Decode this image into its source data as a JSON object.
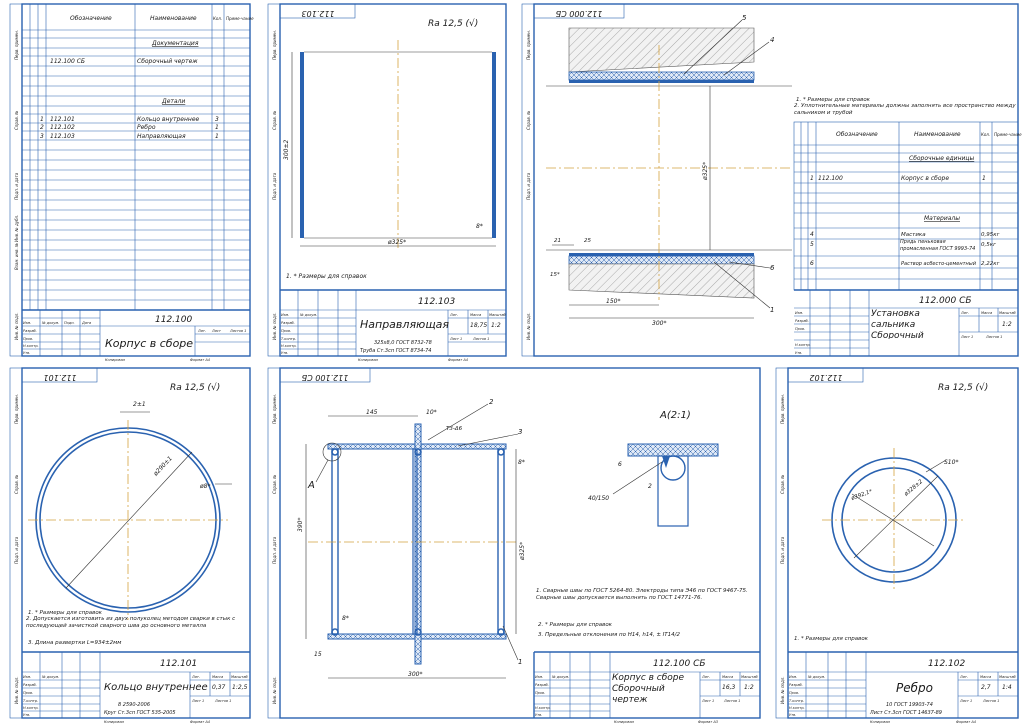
{
  "spec_sheet": {
    "headers": {
      "designation": "Обозначение",
      "name": "Наименование",
      "qty": "Кол.",
      "note": "Приме-чание"
    },
    "section_docs": "Документация",
    "doc_row": {
      "code": "112.100 СБ",
      "name": "Сборочный чертеж"
    },
    "section_parts": "Детали",
    "parts": [
      {
        "pos": "1",
        "code": "112.101",
        "name": "Кольцо внутреннее",
        "qty": "3"
      },
      {
        "pos": "2",
        "code": "112.102",
        "name": "Ребро",
        "qty": "1"
      },
      {
        "pos": "3",
        "code": "112.103",
        "name": "Направляющая",
        "qty": "1"
      }
    ],
    "code": "112.100",
    "title": "Корпус в сборе",
    "copied": "Копировал",
    "format": "Формат А4"
  },
  "guide_sheet": {
    "mirror_code": "112.103",
    "roughness": "Ra 12,5 (√)",
    "dim_height": "300±2",
    "dim_diam": "ø325*",
    "dim_wall": "8*",
    "note": "1. * Размеры для справок",
    "code": "112.103",
    "title": "Направляющая",
    "mass": "18,75",
    "scale": "1:2",
    "material_1": "325х8,0 ГОСТ 8732-78",
    "material_2": "Труба Ст.3сп ГОСТ 8734-74",
    "copied": "Копировал",
    "format": "Формат А4"
  },
  "gland_sheet": {
    "mirror_code": "112.000 СБ",
    "callouts": [
      "5",
      "4",
      "6",
      "1"
    ],
    "dim_diam": "ø325*",
    "dim_21": "21",
    "dim_25": "25",
    "dim_15": "15*",
    "dim_150": "150*",
    "dim_300": "300*",
    "notes": [
      "1. * Размеры для справок",
      "2. Уплотнительные материалы должны заполнять все пространство между сальником и трубой"
    ],
    "headers": {
      "designation": "Обозначение",
      "name": "Наименование",
      "qty": "Кол.",
      "note": "Приме-чание"
    },
    "section_units": "Сборочные единицы",
    "unit_row": {
      "pos": "1",
      "code": "112.100",
      "name": "Корпус в сборе",
      "qty": "1"
    },
    "section_materials": "Материалы",
    "materials": [
      {
        "pos": "4",
        "name": "Мастика",
        "qty": "0,95кг"
      },
      {
        "pos": "5",
        "name": "Прядь пеньковая промасленная ГОСТ 9993-74",
        "qty": "0,5кг"
      },
      {
        "pos": "6",
        "name": "Раствор асбесто-цементный",
        "qty": "2,22кг"
      }
    ],
    "code": "112.000 СБ",
    "title": "Установка сальника Сборочный чертеж",
    "scale": "1:2"
  },
  "ring_sheet": {
    "mirror_code": "112.101",
    "roughness": "Ra 12,5 (√)",
    "dim_gap": "2±1",
    "dim_diam": "ø290±1",
    "dim_wall": "ø8*",
    "notes": [
      "1. * Размеры для справок",
      "2. Допускается изготовить из двух полуколец методом сварки в стык с последующей зачисткой сварного шва до основного металла",
      "3. Длина развертки L=934±2мм"
    ],
    "code": "112.101",
    "title": "Кольцо внутреннее",
    "mass": "0,37",
    "scale": "1:2,5",
    "material_1": "8 2590-2006",
    "material_2": "Круг Ст.3сп ГОСТ 535-2005",
    "copied": "Копировал",
    "format": "Формат А4"
  },
  "assembly_sheet": {
    "mirror_code": "112.100 СБ",
    "callouts": [
      "2",
      "3",
      "1"
    ],
    "dim_145": "145",
    "dim_10": "10*",
    "weld_mark": "Т3-Δ6",
    "view_label": "А",
    "detail_label": "А(2:1)",
    "dim_390": "390*",
    "dim_325": "ø325*",
    "dim_8a": "8*",
    "dim_8b": "8*",
    "dim_15": "15",
    "dim_300": "300*",
    "detail_dim_6": "6",
    "detail_dim_2": "2",
    "detail_dim_40": "40/150",
    "notes": [
      "1. Сварные швы по ГОСТ 5264-80. Электроды типа Э46 по ГОСТ 9467-75. Сварные швы допускается выполнять по ГОСТ 14771-76.",
      "2. * Размеры для справок",
      "3. Предельные отклонения по Н14, h14, ± IT14/2"
    ],
    "code": "112.100 СБ",
    "title": "Корпус в сборе Сборочный чертеж",
    "mass": "16,3",
    "scale": "1:2",
    "copied": "Копировал",
    "format": "Формат А3"
  },
  "rib_sheet": {
    "mirror_code": "112.102",
    "roughness": "Ra 12,5 (√)",
    "dim_thick": "S10*",
    "dim_outer": "ø392,1*",
    "dim_inner": "ø328±2",
    "note": "1. * Размеры для справок",
    "code": "112.102",
    "title": "Ребро",
    "mass": "2,7",
    "scale": "1:4",
    "material_1": "10 ГОСТ 19903-74",
    "material_2": "Лист Ст.3сп ГОСТ 14637-89",
    "copied": "Копировал",
    "format": "Формат А4"
  },
  "stamp_labels": {
    "izm": "Изм.",
    "list": "Лист",
    "ndoc": "№ докум.",
    "podp": "Подп.",
    "data": "Дата",
    "razrab": "Разраб.",
    "prov": "Пров.",
    "tkontr": "Т.контр.",
    "nkontr": "Н.контр.",
    "utv": "Утв.",
    "lit": "Лит.",
    "massa": "Масса",
    "masshtab": "Масштаб",
    "sheet": "Лист",
    "sheets": "Листов 1",
    "sheet_num": "Лист 1"
  },
  "margin_labels": [
    "Перв. примен.",
    "Справ. №",
    "Подп. и дата",
    "Инв. № дубл.",
    "Взам. инв. №",
    "Подп. и дата",
    "Инв. № подл."
  ]
}
